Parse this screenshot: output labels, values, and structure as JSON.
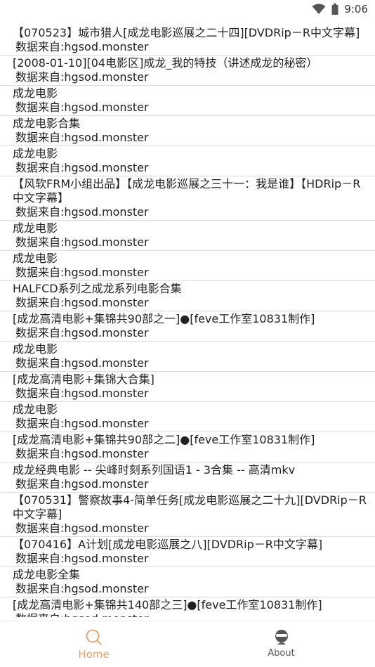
{
  "status_bar": {
    "time": "9:06",
    "wifi_icon": "wifi-icon",
    "battery_icon": "battery-icon"
  },
  "list": {
    "items": [
      {
        "title": "【070523】城市猎人[成龙电影巡展之二十四][DVDRip－R中文字幕]",
        "source": "数据来自:hgsod.monster"
      },
      {
        "title": "[2008-01-10][04电影区]成龙_我的特技（讲述成龙的秘密）",
        "source": "数据来自:hgsod.monster"
      },
      {
        "title": "成龙电影",
        "source": "数据来自:hgsod.monster"
      },
      {
        "title": "成龙电影合集",
        "source": "数据来自:hgsod.monster"
      },
      {
        "title": "成龙电影",
        "source": "数据来自:hgsod.monster"
      },
      {
        "title": "【风软FRM小组出品】【成龙电影巡展之三十一：我是谁】【HDRip－R中文字幕】",
        "source": "数据来自:hgsod.monster"
      },
      {
        "title": "成龙电影",
        "source": "数据来自:hgsod.monster"
      },
      {
        "title": "成龙电影",
        "source": "数据来自:hgsod.monster"
      },
      {
        "title": "HALFCD系列之成龙系列电影合集",
        "source": "数据来自:hgsod.monster"
      },
      {
        "title": "[成龙高清电影+集锦共90部之一]●[feve工作室10831制作]",
        "source": "数据来自:hgsod.monster"
      },
      {
        "title": "成龙电影",
        "source": "数据来自:hgsod.monster"
      },
      {
        "title": "[成龙高清电影+集锦大合集]",
        "source": "数据来自:hgsod.monster"
      },
      {
        "title": "成龙电影",
        "source": "数据来自:hgsod.monster"
      },
      {
        "title": "[成龙高清电影+集锦共90部之二]●[feve工作室10831制作]",
        "source": "数据来自:hgsod.monster"
      },
      {
        "title": "成龙经典电影 -- 尖峰时刻系列国语1 - 3合集 -- 高清mkv",
        "source": "数据来自:hgsod.monster"
      },
      {
        "title": "【070531】警察故事4-简单任务[成龙电影巡展之二十九][DVDRip－R中文字幕]",
        "source": "数据来自:hgsod.monster"
      },
      {
        "title": "【070416】A计划[成龙电影巡展之八][DVDRip－R中文字幕]",
        "source": "数据来自:hgsod.monster"
      },
      {
        "title": "成龙电影全集",
        "source": "数据来自:hgsod.monster"
      },
      {
        "title": "[成龙高清电影+集锦共140部之三]●[feve工作室10831制作]",
        "source": "数据来自:hgsod.monster"
      }
    ]
  },
  "bottom_nav": {
    "home": {
      "label": "Home",
      "icon": "search-icon",
      "active_color": "#e8a06a"
    },
    "about": {
      "label": "About",
      "icon": "about-avatar-icon"
    }
  }
}
